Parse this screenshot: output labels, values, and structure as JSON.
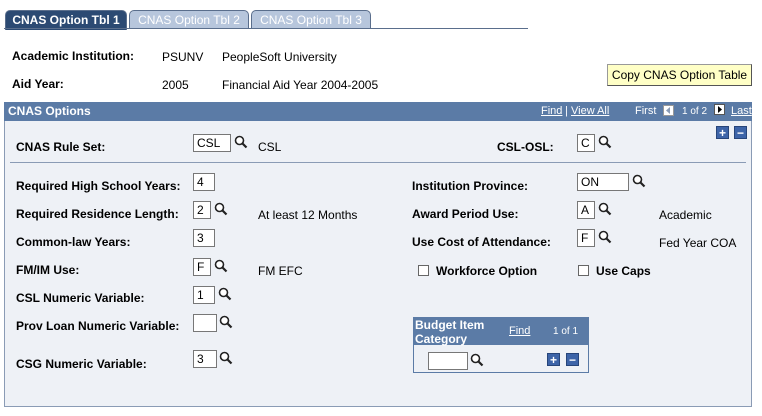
{
  "tabs": [
    {
      "label": "CNAS Option Tbl 1",
      "active": true
    },
    {
      "label": "CNAS Option Tbl 2",
      "active": false
    },
    {
      "label": "CNAS Option Tbl 3",
      "active": false
    }
  ],
  "header": {
    "institution_label": "Academic Institution:",
    "institution_code": "PSUNV",
    "institution_name": "PeopleSoft University",
    "aid_year_label": "Aid Year:",
    "aid_year_value": "2005",
    "aid_year_desc": "Financial Aid Year 2004-2005",
    "copy_button": "Copy CNAS Option Table"
  },
  "panel": {
    "title": "CNAS Options",
    "find": "Find",
    "divider": "|",
    "view_all": "View All",
    "first": "First",
    "page_info": "1 of 2",
    "last": "Last"
  },
  "fields": {
    "rule_set_label": "CNAS Rule Set:",
    "rule_set_value": "CSL",
    "rule_set_desc": "CSL",
    "csl_osl_label": "CSL-OSL:",
    "csl_osl_value": "C",
    "req_hs_years_label": "Required High School Years:",
    "req_hs_years_value": "4",
    "req_res_length_label": "Required Residence Length:",
    "req_res_length_value": "2",
    "req_res_length_desc": "At least 12 Months",
    "common_law_label": "Common-law Years:",
    "common_law_value": "3",
    "fmim_label": "FM/IM Use:",
    "fmim_value": "F",
    "fmim_desc": "FM EFC",
    "csl_numeric_label": "CSL Numeric Variable:",
    "csl_numeric_value": "1",
    "prov_loan_label": "Prov Loan Numeric Variable:",
    "prov_loan_value": "",
    "csg_numeric_label": "CSG Numeric Variable:",
    "csg_numeric_value": "3",
    "inst_province_label": "Institution Province:",
    "inst_province_value": "ON",
    "award_period_label": "Award Period Use:",
    "award_period_value": "A",
    "award_period_desc": "Academic",
    "cost_attendance_label": "Use Cost of Attendance:",
    "cost_attendance_value": "F",
    "cost_attendance_desc": "Fed Year COA",
    "workforce_label": "Workforce Option",
    "use_caps_label": "Use Caps"
  },
  "budget": {
    "title_line1": "Budget Item",
    "title_line2": "Category",
    "find": "Find",
    "page_info": "1 of 1",
    "value": ""
  },
  "colors": {
    "tab_active": "#2c4a73",
    "tab_inactive": "#b7c6dc",
    "panel_header": "#5b7ba6",
    "panel_bg": "#eef1f6",
    "button_bg": "#ffffc6"
  }
}
